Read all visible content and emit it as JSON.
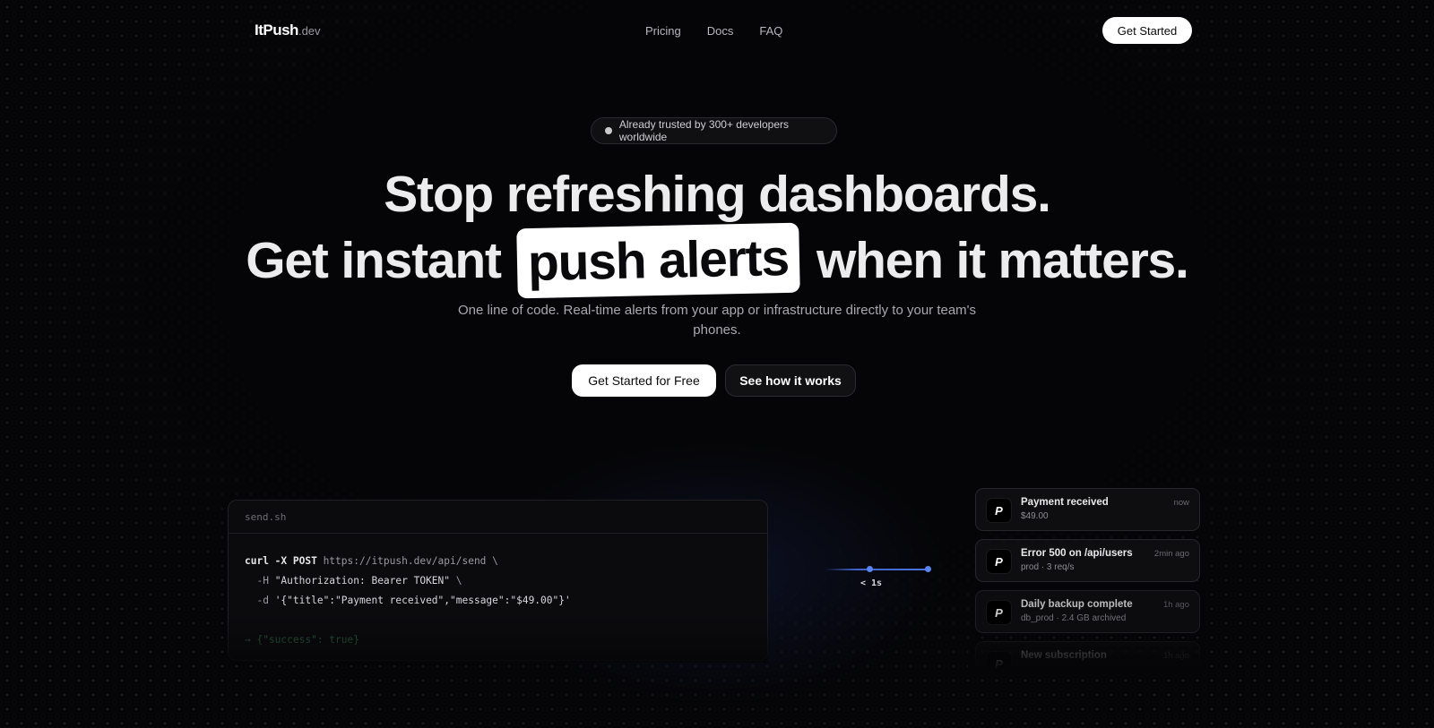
{
  "nav": {
    "logo_main": "ItPush",
    "logo_tld": ".dev",
    "links": [
      "Pricing",
      "Docs",
      "FAQ"
    ],
    "cta": "Get Started"
  },
  "hero": {
    "badge": "Already trusted by 300+ developers worldwide",
    "headline_line1": "Stop refreshing dashboards.",
    "headline_pre": "Get instant",
    "headline_highlight": "push alerts",
    "headline_post": "when it matters.",
    "subtitle": "One line of code. Real-time alerts from your app or infrastructure directly to your team's phones.",
    "primary_cta": "Get Started for Free",
    "secondary_cta": "See how it works"
  },
  "code": {
    "filename": "send.sh",
    "line1_cmd": "curl -X POST",
    "line1_url": " https://itpush.dev/api/send \\",
    "line2_flag": "  -H ",
    "line2_str": "\"Authorization: Bearer TOKEN\"",
    "line2_end": " \\",
    "line3_flag": "  -d ",
    "line3_str": "'{\"title\":\"Payment received\",\"message\":\"$49.00\"}'",
    "response": "→ {\"success\": true}"
  },
  "connector": {
    "label": "< 1s"
  },
  "notifications": [
    {
      "title": "Payment received",
      "body": "$49.00",
      "time": "now"
    },
    {
      "title": "Error 500 on /api/users",
      "body": "prod · 3 req/s",
      "time": "2min ago"
    },
    {
      "title": "Daily backup complete",
      "body": "db_prod · 2.4 GB archived",
      "time": "1h ago"
    },
    {
      "title": "New subscription",
      "body": "",
      "time": "1h ago"
    }
  ],
  "colors": {
    "background": "#050507",
    "accent": "#4a72e0",
    "highlight_bg": "#ffffff"
  }
}
